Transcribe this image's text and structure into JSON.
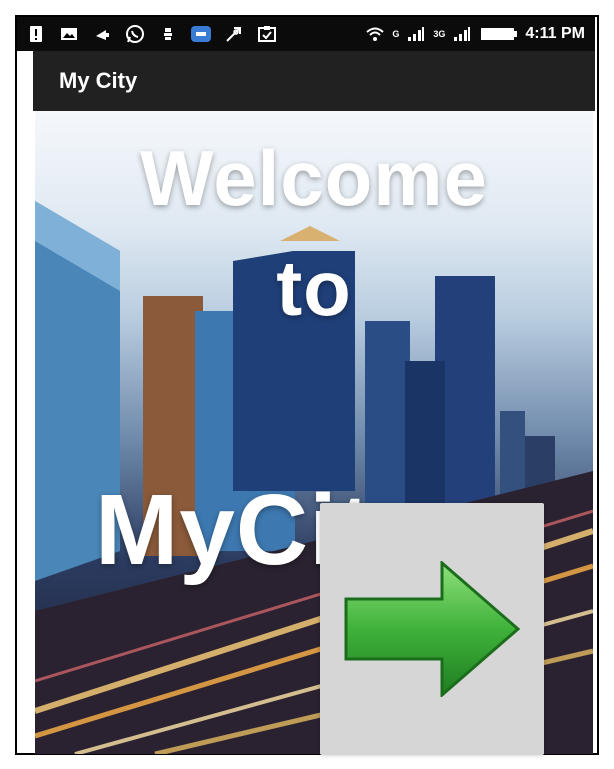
{
  "status_bar": {
    "network_labels": [
      "G",
      "3G"
    ],
    "time": "4:11 PM",
    "icons": [
      "alert-icon",
      "photos-icon",
      "notify-icon",
      "whatsapp-icon",
      "emblem-icon",
      "app-icon",
      "rocket-icon",
      "clipboard-icon",
      "wifi-icon",
      "signal-icon",
      "battery-icon"
    ]
  },
  "app_bar": {
    "title": "My City"
  },
  "hero": {
    "line1": "Welcome",
    "line2": "to",
    "line3": "MyCity"
  },
  "next_button": {
    "icon": "arrow-right-icon",
    "color": "#3fb23a"
  }
}
